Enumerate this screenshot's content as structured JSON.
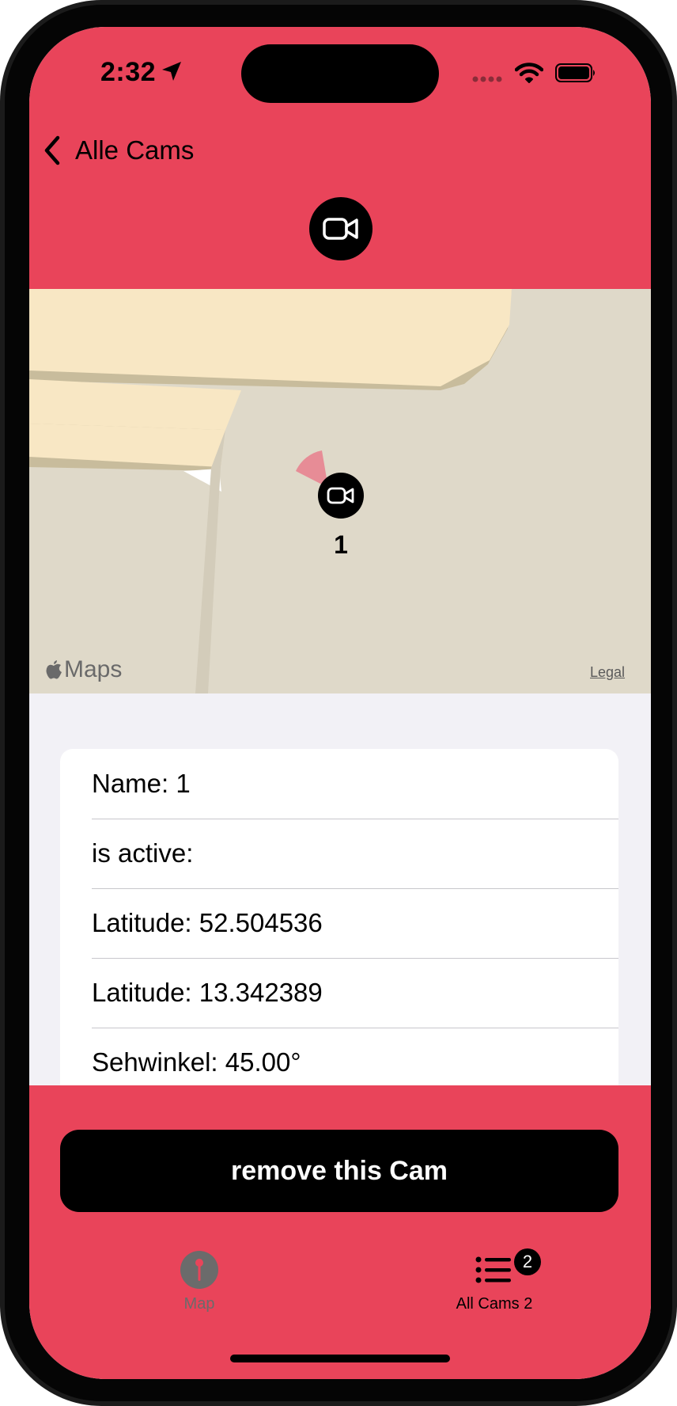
{
  "status_bar": {
    "time": "2:32"
  },
  "nav": {
    "back_label": "Alle Cams"
  },
  "map": {
    "logo_label": "Maps",
    "legal_label": "Legal",
    "marker_label": "1"
  },
  "details": {
    "rows": [
      {
        "label": "Name: 1"
      },
      {
        "label": "is active:"
      },
      {
        "label": "Latitude: 52.504536"
      },
      {
        "label": "Latitude: 13.342389"
      },
      {
        "label": "Sehwinkel: 45.00°"
      }
    ]
  },
  "actions": {
    "remove_label": "remove this Cam"
  },
  "tab_bar": {
    "tabs": [
      {
        "label": "Map",
        "icon": "map-pin-icon",
        "selected": false
      },
      {
        "label": "All Cams 2",
        "icon": "list-icon",
        "selected": true,
        "badge": "2"
      }
    ]
  },
  "colors": {
    "accent": "#e9445a",
    "tab_active": "#000000",
    "tab_inactive": "#6b6b6b"
  }
}
